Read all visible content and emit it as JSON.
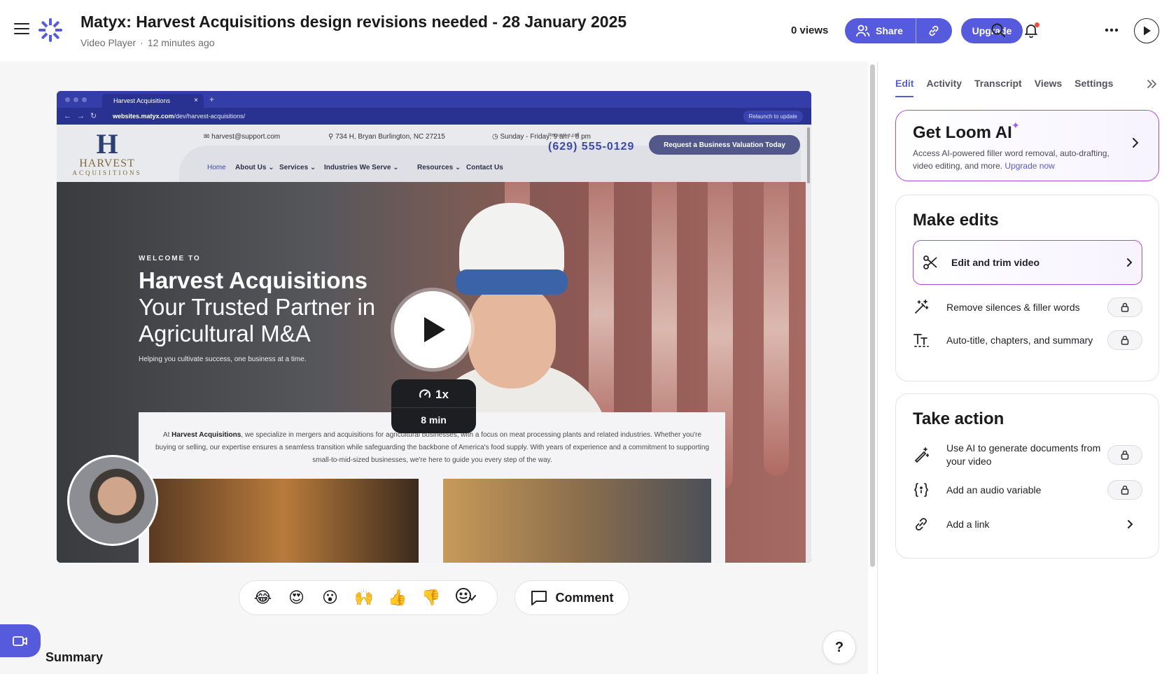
{
  "header": {
    "title": "Matyx: Harvest Acquisitions design revisions needed - 28 January 2025",
    "subtitle_source": "Video Player",
    "subtitle_time": "12 minutes ago",
    "views": "0 views",
    "share_label": "Share",
    "upgrade_label": "Upgrade",
    "accent_color": "#565add"
  },
  "video": {
    "browser": {
      "tab_title": "Harvest Acquisitions",
      "url_domain": "websites.matyx.com",
      "url_path": "/dev/harvest-acquisitions/",
      "relaunch": "Relaunch to update"
    },
    "site": {
      "logo_letter": "H",
      "logo_name": "HARVEST",
      "logo_sub": "ACQUISITIONS",
      "email": "harvest@support.com",
      "address": "734 H, Bryan Burlington, NC 27215",
      "hours": "Sunday - Friday: 9 am - 8 pm",
      "nav": [
        "Home",
        "About Us ⌄",
        "Services ⌄",
        "Industries We Serve ⌄",
        "Resources ⌄",
        "Contact Us"
      ],
      "call_label": "Request a call",
      "phone": "(629) 555-0129",
      "cta": "Request a Business Valuation Today",
      "welcome": "WELCOME TO",
      "hero_title": "Harvest Acquisitions",
      "hero_tagline": "Your Trusted Partner in Agricultural M&A",
      "hero_sub": "Helping you cultivate success, one business at a time.",
      "intro_prefix": "At ",
      "intro_company": "Harvest Acquisitions",
      "intro_body": ", we specialize in mergers and acquisitions for agricultural businesses, with a focus on meat processing plants and related industries. Whether you're buying or selling, our expertise ensures a seamless transition while safeguarding the backbone of America's food supply. With years of experience and a commitment to supporting small-to-mid-sized businesses, we're here to guide you every step of the way."
    },
    "speed": "1x",
    "duration": "8 min"
  },
  "reactions": [
    "😂",
    "😍",
    "😮",
    "🙌",
    "👍",
    "👎"
  ],
  "comment_label": "Comment",
  "summary_label": "Summary",
  "help_label": "?",
  "sidebar": {
    "tabs": [
      "Edit",
      "Activity",
      "Transcript",
      "Views",
      "Settings"
    ],
    "active_tab": "Edit",
    "ai_card": {
      "title": "Get Loom AI",
      "desc": "Access AI-powered filler word removal, auto-drafting, video editing, and more. ",
      "link": "Upgrade now"
    },
    "make_edits": {
      "title": "Make edits",
      "edit_trim": "Edit and trim video",
      "remove_silences": "Remove silences & filler words",
      "auto_title": "Auto-title, chapters, and summary"
    },
    "take_action": {
      "title": "Take action",
      "generate_docs": "Use AI to generate documents from your video",
      "audio_variable": "Add an audio variable",
      "add_link": "Add a link"
    }
  }
}
